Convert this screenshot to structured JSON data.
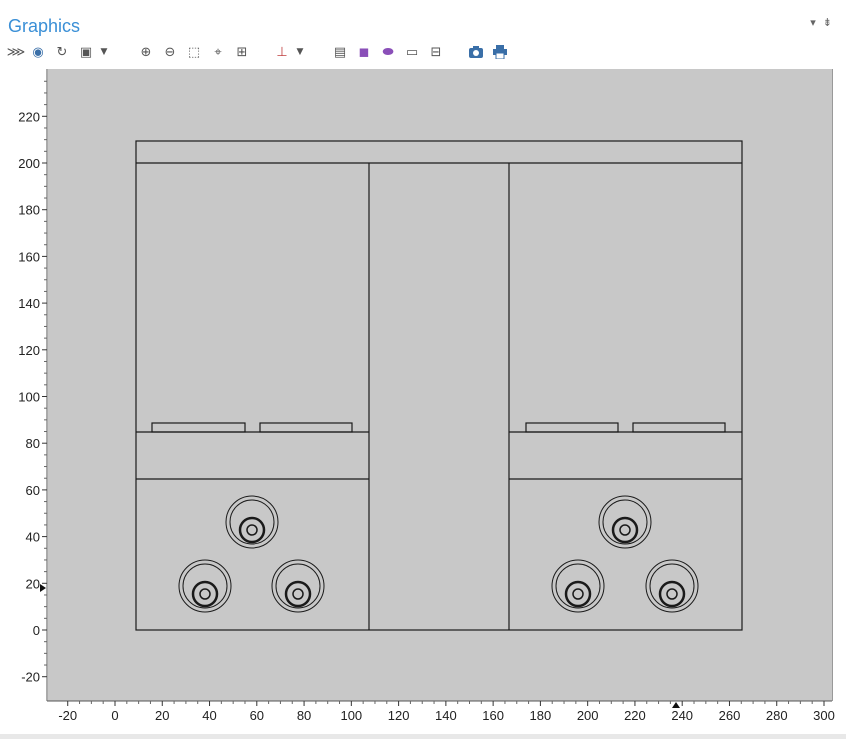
{
  "panel": {
    "title": "Graphics",
    "controls": [
      "▾",
      "⇟"
    ]
  },
  "toolbar": {
    "buttons": [
      {
        "name": "select-objects-icon",
        "glyph": "⋙"
      },
      {
        "name": "visibility-eye-icon",
        "glyph": "◉"
      },
      {
        "name": "refresh-icon",
        "glyph": "↻"
      },
      {
        "name": "views-dropdown-icon",
        "glyph": "▣"
      },
      {
        "name": "zoom-in-icon",
        "glyph": "⊕"
      },
      {
        "name": "zoom-out-icon",
        "glyph": "⊖"
      },
      {
        "name": "zoom-box-icon",
        "glyph": "⬚"
      },
      {
        "name": "zoom-selected-icon",
        "glyph": "⌖"
      },
      {
        "name": "zoom-extents-icon",
        "glyph": "⊞"
      },
      {
        "name": "axis-orientation-icon",
        "glyph": "⊥"
      },
      {
        "name": "select-domains-icon",
        "glyph": "▤"
      },
      {
        "name": "select-boundaries-icon",
        "glyph": "◼"
      },
      {
        "name": "select-edges-icon",
        "glyph": "⬬"
      },
      {
        "name": "select-points-icon",
        "glyph": "▭"
      },
      {
        "name": "transparency-icon",
        "glyph": "⊟"
      },
      {
        "name": "camera-icon",
        "glyph": "📷"
      },
      {
        "name": "print-icon",
        "glyph": "⎙"
      }
    ]
  },
  "axes": {
    "x_ticks": [
      "-20",
      "0",
      "20",
      "40",
      "60",
      "80",
      "100",
      "120",
      "140",
      "160",
      "180",
      "200",
      "220",
      "240",
      "260",
      "280",
      "300"
    ],
    "y_ticks": [
      "-20",
      "0",
      "20",
      "40",
      "60",
      "80",
      "100",
      "120",
      "140",
      "160",
      "180",
      "200",
      "220"
    ]
  },
  "colors": {
    "accent": "#3a8fd6",
    "plot_background": "#c8c8c8",
    "geometry_stroke": "#1a1a1a",
    "selected_icon": "#8a4fb8"
  }
}
